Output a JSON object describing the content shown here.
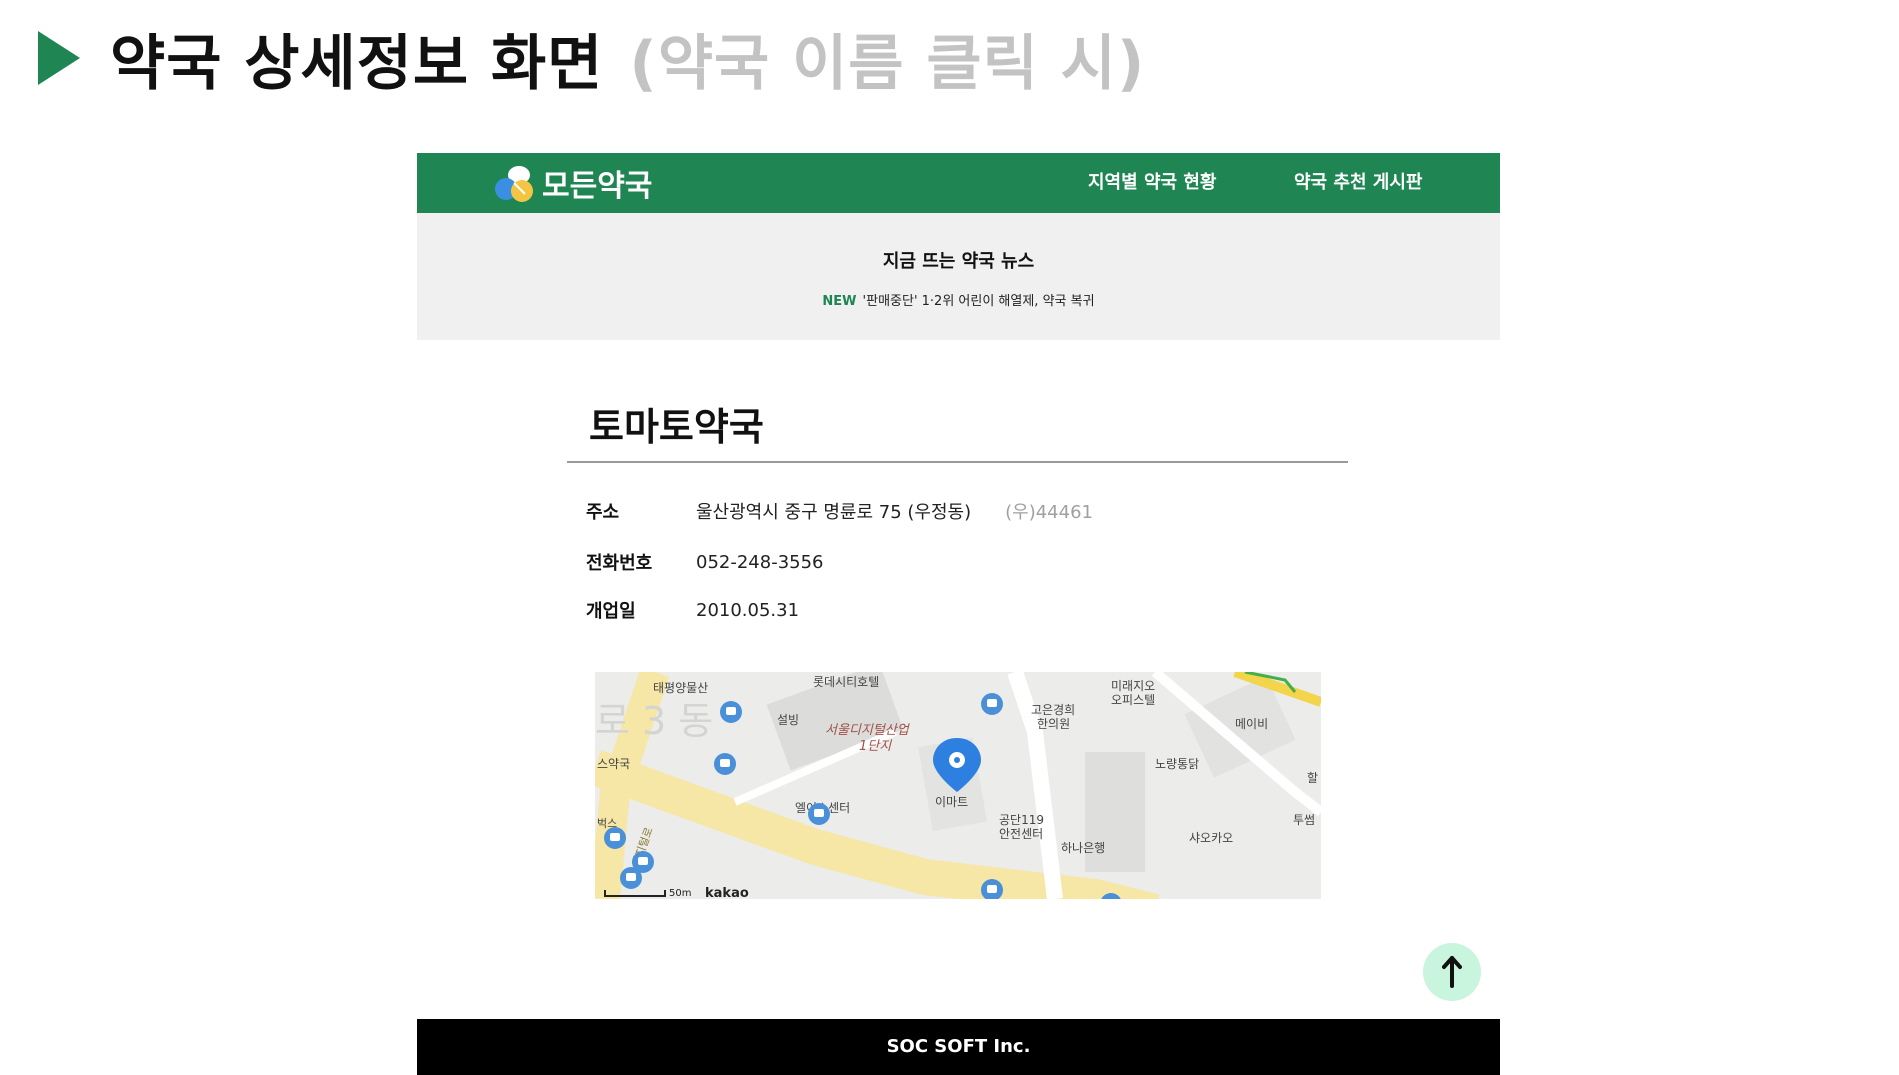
{
  "slide": {
    "title": "약국 상세정보 화면",
    "subtitle": "(약국 이름 클릭 시)",
    "marker_icon": "play-triangle-icon",
    "accent": "#1e8553"
  },
  "header": {
    "brand": "모든약국",
    "logo_icon": "pill-logo-icon",
    "bg": "#1e8553",
    "nav": [
      "지역별 약국 현황",
      "약국 추천 게시판"
    ]
  },
  "news": {
    "heading": "지금 뜨는 약국 뉴스",
    "badge": "NEW",
    "headline": "'판매중단' 1·2위 어린이 해열제, 약국 복귀"
  },
  "pharmacy": {
    "name": "토마토약국",
    "address_label": "주소",
    "address": "울산광역시 중구 명륜로 75 (우정동)",
    "postal": "(우)44461",
    "phone_label": "전화번호",
    "phone": "052-248-3556",
    "opened_label": "개업일",
    "opened": "2010.05.31"
  },
  "map": {
    "labels": {
      "taepyeong": "태평양물산",
      "lotte": "롯데시티호텔",
      "mirae": "미래지오",
      "office": "오피스텔",
      "goeun1": "고은경희",
      "goeun2": "한의원",
      "maybe": "메이비",
      "seolbing": "설빙",
      "digital1": "서울디지털산업",
      "digital2": "1단지",
      "emart": "이마트",
      "noryang": "노량통닭",
      "pharm": "스약국",
      "ace": "엘이스센터",
      "gongdan1": "공단119",
      "gongdan2": "안전센터",
      "hana": "하나은행",
      "shaokao": "샤오카오",
      "tu": "투썸",
      "hal": "할",
      "road": "로 3 동",
      "dr": "디지털로",
      "beo": "벅스",
      "scale": "50m",
      "brand": "kakao"
    },
    "marker_icon": "location-pin-icon"
  },
  "scroll_top": {
    "icon": "arrow-up-icon"
  },
  "footer": {
    "text": "SOC SOFT Inc."
  }
}
